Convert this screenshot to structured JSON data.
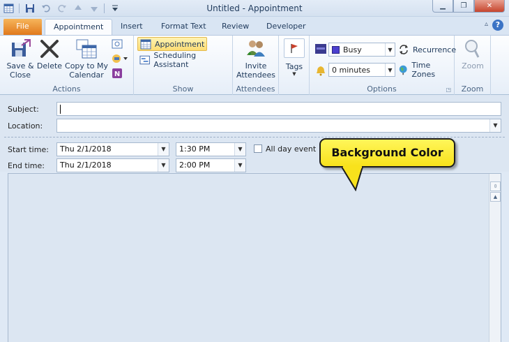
{
  "window": {
    "title": "Untitled  -  Appointment"
  },
  "tabs": [
    {
      "label": "File"
    },
    {
      "label": "Appointment"
    },
    {
      "label": "Insert"
    },
    {
      "label": "Format Text"
    },
    {
      "label": "Review"
    },
    {
      "label": "Developer"
    }
  ],
  "ribbon": {
    "actions": {
      "label": "Actions",
      "save_close": "Save &\nClose",
      "save_close_1": "Save &",
      "save_close_2": "Close",
      "delete": "Delete",
      "copy_1": "Copy to My",
      "copy_2": "Calendar"
    },
    "show": {
      "label": "Show",
      "appointment": "Appointment",
      "scheduling": "Scheduling Assistant"
    },
    "attendees": {
      "label": "Attendees",
      "invite_1": "Invite",
      "invite_2": "Attendees"
    },
    "tags": {
      "label": "Tags"
    },
    "options": {
      "label": "Options",
      "show_as": "Busy",
      "reminder": "0 minutes",
      "recurrence": "Recurrence",
      "time_zones": "Time Zones"
    },
    "zoom": {
      "label": "Zoom",
      "button": "Zoom"
    }
  },
  "form": {
    "subject_label": "Subject:",
    "subject_value": "",
    "location_label": "Location:",
    "location_value": "",
    "start_label": "Start time:",
    "start_date": "Thu 2/1/2018",
    "start_time": "1:30 PM",
    "end_label": "End time:",
    "end_date": "Thu 2/1/2018",
    "end_time": "2:00 PM",
    "all_day": "All day event"
  },
  "callout": {
    "text": "Background Color"
  },
  "colors": {
    "body_background": "#dce6f2",
    "callout": "#fbee3a",
    "file_tab": "#e8832a"
  }
}
